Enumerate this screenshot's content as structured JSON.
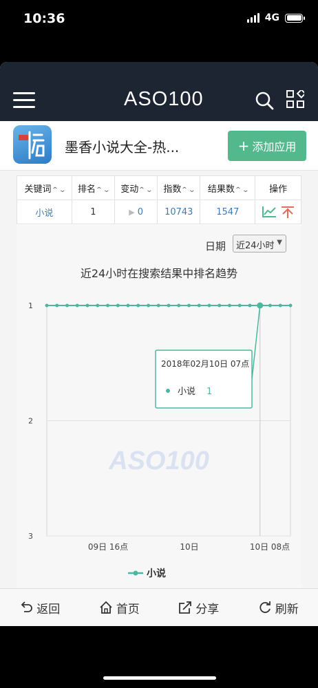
{
  "status_bar": {
    "time": "10:36",
    "network": "4G"
  },
  "nav": {
    "logo_left": "AS",
    "logo_mid": "O",
    "logo_right": "1",
    "logo_end": "00"
  },
  "app": {
    "title": "墨香小说大全-热...",
    "add_label": "添加应用",
    "add_symbol": "+"
  },
  "table": {
    "headers": [
      "关键词",
      "排名",
      "变动",
      "指数",
      "结果数",
      "操作"
    ],
    "row": {
      "keyword": "小说",
      "rank": "1",
      "change": "0",
      "index": "10743",
      "results": "1547"
    }
  },
  "chart_controls": {
    "date_label": "日期",
    "range_selected": "近24小时"
  },
  "chart_data": {
    "type": "line",
    "title": "近24小时在搜索结果中排名趋势",
    "ylim": [
      1,
      3
    ],
    "y_inverted": true,
    "y_ticks": [
      "1",
      "2",
      "3"
    ],
    "x_tick_labels": [
      "09日 16点",
      "10日",
      "10日 08点"
    ],
    "series": [
      {
        "name": "小说",
        "values": [
          1,
          1,
          1,
          1,
          1,
          1,
          1,
          1,
          1,
          1,
          1,
          1,
          1,
          1,
          1,
          1,
          1,
          1,
          1,
          1,
          1,
          1,
          1,
          1,
          1
        ],
        "color": "#4db6a0"
      }
    ],
    "highlight_index": 21,
    "tooltip": {
      "date": "2018年02月10日 07点",
      "series_name": "小说",
      "value": "1"
    },
    "legend_position": "bottom",
    "watermark": "ASO100"
  },
  "bottom_bar": {
    "back": "返回",
    "home": "首页",
    "share": "分享",
    "refresh": "刷新"
  },
  "colors": {
    "nav_bg": "#1e2532",
    "accent": "#53b88c",
    "line": "#4db6a0",
    "logo_accent": "#f0a44a"
  }
}
